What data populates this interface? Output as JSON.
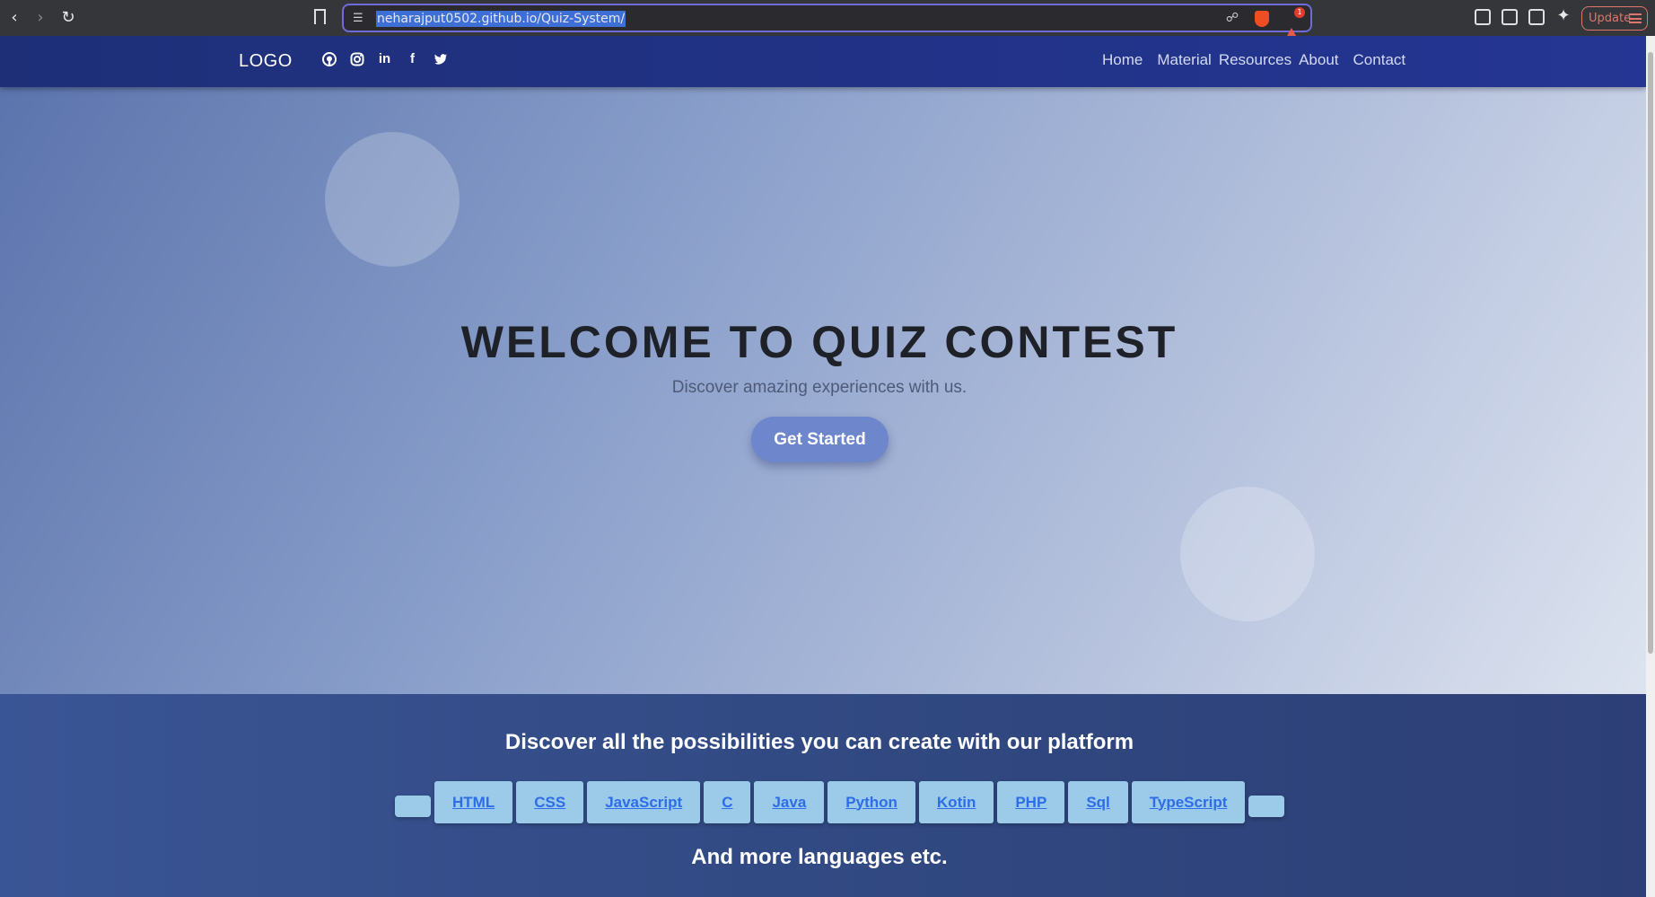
{
  "browser": {
    "url": "neharajput0502.github.io/Quiz-System/",
    "update_label": "Update",
    "rewards_count": "1"
  },
  "site": {
    "logo": "LOGO",
    "socials": [
      {
        "name": "github-icon"
      },
      {
        "name": "instagram-icon"
      },
      {
        "name": "linkedin-icon",
        "glyph": "in"
      },
      {
        "name": "facebook-icon",
        "glyph": "f"
      },
      {
        "name": "twitter-icon"
      }
    ],
    "nav": [
      "Home",
      "Material",
      "Resources",
      "About",
      "Contact"
    ]
  },
  "hero": {
    "title": "WELCOME TO QUIZ CONTEST",
    "subtitle": "Discover amazing experiences with us.",
    "cta": "Get Started"
  },
  "languages_section": {
    "heading": "Discover all the possibilities you can create with our platform",
    "languages": [
      "HTML",
      "CSS",
      "JavaScript",
      "C",
      "Java",
      "Python",
      "Kotin",
      "PHP",
      "Sql",
      "TypeScript"
    ],
    "footer_text": "And more languages etc."
  },
  "colors": {
    "nav_bg": "#243593",
    "cta_bg": "#6d86cc",
    "lang_chip_bg": "#9ccbe9",
    "lang_link": "#2d6de8"
  }
}
